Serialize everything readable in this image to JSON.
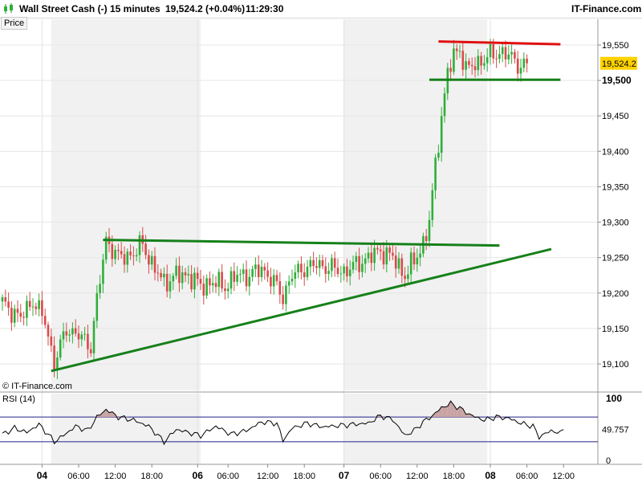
{
  "header": {
    "instrument": "Wall Street Cash (-)",
    "timeframe": "15 minutes",
    "quote": "19,524.2 (+0.04%)",
    "time": "11:29:30",
    "brand": "IT-Finance.com"
  },
  "price_tab": "Price",
  "rsi_tab": "RSI (14)",
  "copyright": "© IT-Finance.com",
  "colors": {
    "up": "#2fae3a",
    "down": "#d94a4a",
    "trend_green": "#16801a",
    "resistance_red": "#e01010",
    "rsi_line": "#000000",
    "rsi_band": "#20208a",
    "rsi_fill": "#c8a4a4",
    "shade": "#f1f1f1",
    "badge": "#ffd200"
  },
  "chart_data": [
    {
      "type": "candlestick",
      "panel": "price",
      "ylim": [
        19080,
        19575
      ],
      "yticks": [
        19100,
        19150,
        19200,
        19250,
        19300,
        19350,
        19400,
        19450,
        19500,
        19550
      ],
      "ytick_labels": [
        "19,100",
        "19,150",
        "19,200",
        "19,250",
        "19,300",
        "19,350",
        "19,400",
        "19,450",
        "19,500",
        "19,550"
      ],
      "highlight_tick_label": "19,500",
      "last_price": 19524.2,
      "last_price_label": "19,524.2",
      "x_labels": [
        "18:00",
        "04",
        "06:00",
        "12:00",
        "18:00",
        "06",
        "06:00",
        "12:00",
        "18:00",
        "07",
        "06:00",
        "12:00",
        "18:00",
        "08",
        "06:00",
        "12:00"
      ],
      "bold_x_labels": [
        "04",
        "06",
        "07",
        "08"
      ],
      "anchors": [
        [
          0,
          19185
        ],
        [
          6,
          19165
        ],
        [
          10,
          19190
        ],
        [
          14,
          19160
        ],
        [
          17,
          19100
        ],
        [
          21,
          19150
        ],
        [
          25,
          19140
        ],
        [
          29,
          19125
        ],
        [
          31,
          19190
        ],
        [
          34,
          19275
        ],
        [
          38,
          19250
        ],
        [
          43,
          19255
        ],
        [
          46,
          19270
        ],
        [
          49,
          19240
        ],
        [
          53,
          19215
        ],
        [
          57,
          19225
        ],
        [
          61,
          19225
        ],
        [
          65,
          19210
        ],
        [
          69,
          19215
        ],
        [
          73,
          19210
        ],
        [
          77,
          19225
        ],
        [
          81,
          19225
        ],
        [
          85,
          19235
        ],
        [
          89,
          19215
        ],
        [
          92,
          19195
        ],
        [
          95,
          19225
        ],
        [
          99,
          19235
        ],
        [
          103,
          19240
        ],
        [
          108,
          19235
        ],
        [
          112,
          19230
        ],
        [
          116,
          19240
        ],
        [
          120,
          19250
        ],
        [
          124,
          19260
        ],
        [
          128,
          19250
        ],
        [
          132,
          19225
        ],
        [
          135,
          19245
        ],
        [
          138,
          19270
        ],
        [
          140,
          19300
        ],
        [
          142,
          19380
        ],
        [
          144,
          19450
        ],
        [
          146,
          19510
        ],
        [
          148,
          19535
        ],
        [
          150,
          19545
        ],
        [
          152,
          19515
        ],
        [
          156,
          19525
        ],
        [
          160,
          19535
        ],
        [
          164,
          19540
        ],
        [
          166,
          19535
        ],
        [
          170,
          19520
        ],
        [
          172,
          19525
        ]
      ],
      "shaded_sessions_index": [
        [
          16,
          65
        ],
        [
          112,
          159
        ]
      ],
      "trendlines": [
        {
          "name": "rising-support",
          "color": "trend_green",
          "from": [
            16,
            19090
          ],
          "to": [
            180,
            19262
          ]
        },
        {
          "name": "flat-resistance",
          "color": "trend_green",
          "from": [
            33,
            19275
          ],
          "to": [
            163,
            19267
          ]
        },
        {
          "name": "breakout-resistance",
          "color": "resistance_red",
          "from": [
            143,
            19555
          ],
          "to": [
            183,
            19551
          ]
        },
        {
          "name": "breakout-support",
          "color": "trend_green",
          "from": [
            140,
            19501
          ],
          "to": [
            183,
            19501
          ]
        }
      ]
    },
    {
      "type": "line",
      "panel": "rsi",
      "ylim": [
        0,
        100
      ],
      "yticks": [
        0,
        100
      ],
      "ytick_labels": [
        "0",
        "100"
      ],
      "bands": [
        30,
        70
      ],
      "last_value": 49.757,
      "last_value_label": "49.757",
      "anchors": [
        [
          0,
          42
        ],
        [
          4,
          52
        ],
        [
          8,
          45
        ],
        [
          12,
          58
        ],
        [
          15,
          42
        ],
        [
          17,
          30
        ],
        [
          20,
          40
        ],
        [
          24,
          55
        ],
        [
          28,
          48
        ],
        [
          31,
          70
        ],
        [
          34,
          82
        ],
        [
          38,
          70
        ],
        [
          43,
          65
        ],
        [
          48,
          55
        ],
        [
          53,
          30
        ],
        [
          57,
          50
        ],
        [
          61,
          45
        ],
        [
          65,
          40
        ],
        [
          70,
          55
        ],
        [
          75,
          42
        ],
        [
          80,
          48
        ],
        [
          85,
          62
        ],
        [
          90,
          60
        ],
        [
          92,
          32
        ],
        [
          95,
          52
        ],
        [
          100,
          60
        ],
        [
          105,
          54
        ],
        [
          110,
          56
        ],
        [
          115,
          58
        ],
        [
          120,
          60
        ],
        [
          124,
          72
        ],
        [
          128,
          66
        ],
        [
          132,
          40
        ],
        [
          135,
          48
        ],
        [
          138,
          62
        ],
        [
          141,
          72
        ],
        [
          144,
          85
        ],
        [
          147,
          92
        ],
        [
          150,
          84
        ],
        [
          154,
          72
        ],
        [
          158,
          65
        ],
        [
          162,
          70
        ],
        [
          166,
          68
        ],
        [
          170,
          60
        ],
        [
          174,
          55
        ],
        [
          176,
          38
        ],
        [
          180,
          48
        ],
        [
          184,
          42
        ]
      ]
    }
  ]
}
